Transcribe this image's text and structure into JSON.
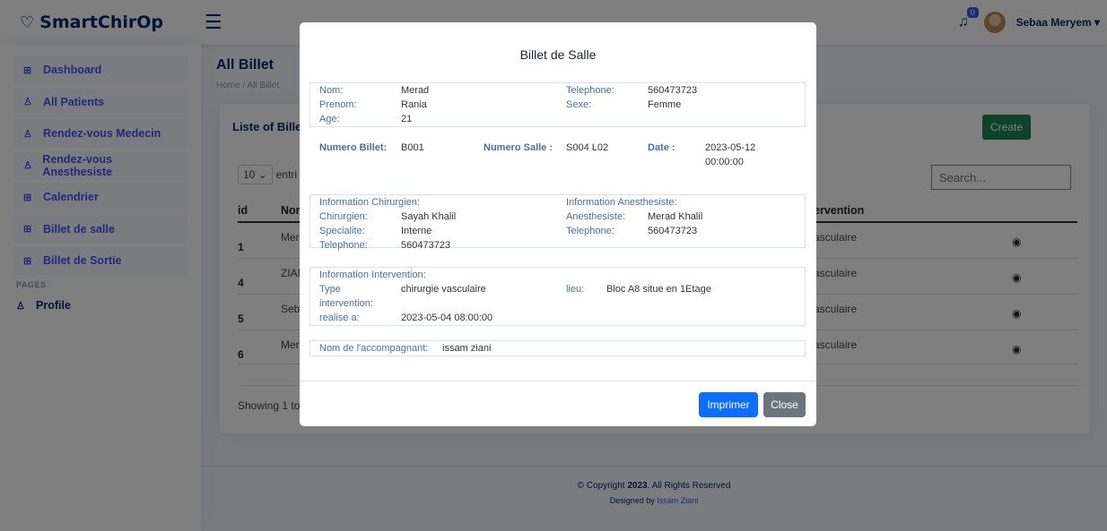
{
  "header": {
    "logo": "SmartChirOp",
    "notifications": "0",
    "user": "Sebaa Meryem ▾"
  },
  "sidebar": {
    "items": [
      {
        "label": "Dashboard",
        "icon": "grid-icon"
      },
      {
        "label": "All Patients",
        "icon": "person-icon"
      },
      {
        "label": "Rendez-vous Medecin",
        "icon": "person-icon"
      },
      {
        "label": "Rendez-vous Anesthesiste",
        "icon": "person-icon"
      },
      {
        "label": "Calendrier",
        "icon": "grid-icon"
      },
      {
        "label": "Billet de salle",
        "icon": "grid-icon"
      },
      {
        "label": "Billet de Sortie",
        "icon": "grid-icon"
      }
    ],
    "pages_heading": "PAGES",
    "profile": "Profile"
  },
  "main": {
    "title": "All Billet",
    "breadcrumb": "Home / All Billet",
    "card_title": "Liste of Bille",
    "create": "Create",
    "entries_value": "10",
    "entries_label": "entri",
    "search_placeholder": "Search...",
    "columns": {
      "id": "id",
      "name": "Nor",
      "intervention": "ervention"
    },
    "rows": [
      {
        "id": "1",
        "name": "Mer",
        "intervention": "asculaire"
      },
      {
        "id": "4",
        "name": "ZIAN",
        "intervention": "asculaire"
      },
      {
        "id": "5",
        "name": "Seb",
        "intervention": "asculaire"
      },
      {
        "id": "6",
        "name": "Mer",
        "intervention": "asculaire"
      }
    ],
    "showing": "Showing 1 to"
  },
  "footer": {
    "copyright_pre": "© Copyright ",
    "year": "2023",
    "copyright_post": ". All Rights Reserved",
    "designed_by": "Designed by ",
    "author": "Issam Ziani"
  },
  "modal": {
    "title": "Billet de Salle",
    "patient": {
      "nom_label": "Nom:",
      "nom": "Merad",
      "prenom_label": "Prenom:",
      "prenom": "Rania",
      "age_label": "Age:",
      "age": "21",
      "tel_label": "Telephone:",
      "tel": "560473723",
      "sexe_label": "Sexe:",
      "sexe": "Femme"
    },
    "billet": {
      "num_label": "Numero Billet:",
      "num": "B001",
      "salle_label": "Numero Salle :",
      "salle": "S004 L02",
      "date_label": "Date :",
      "date_1": "2023-05-12",
      "date_2": "00:00:00"
    },
    "chirurgien": {
      "heading": "Information Chirurgien:",
      "name_label": "Chirurgien:",
      "name": "Sayah Khalil",
      "spec_label": "Specialite:",
      "spec": "Interne",
      "tel_label": "Telephone:",
      "tel": "560473723"
    },
    "anesthesiste": {
      "heading": "Information Anesthesiste:",
      "name_label": "Anesthesiste:",
      "name": "Merad Khalil",
      "tel_label": "Telephone:",
      "tel": "560473723"
    },
    "intervention": {
      "heading": "Information Intervention:",
      "type_label_1": "Type",
      "type_label_2": "intervention:",
      "type": "chirurgie vasculaire",
      "lieu_label": "lieu:",
      "lieu": "Bloc A8 situe en 1Etage",
      "realise_label": "realise a:",
      "realise": "2023-05-04 08:00:00"
    },
    "accompagnant": {
      "label": "Nom de l'accompagnant:",
      "value": "issam ziani"
    },
    "print": "Imprimer",
    "close": "Close"
  }
}
